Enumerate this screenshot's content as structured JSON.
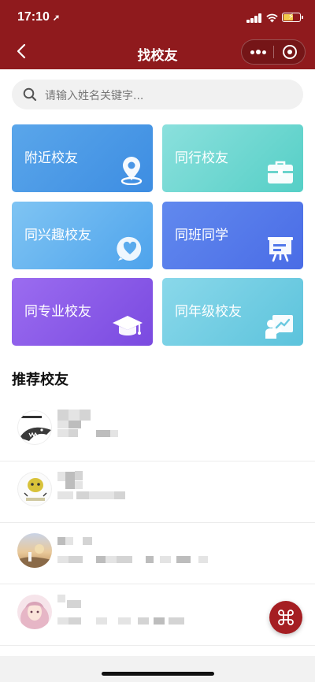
{
  "status_bar": {
    "time": "17:10"
  },
  "nav": {
    "title": "找校友"
  },
  "search": {
    "placeholder": "请输入姓名关键字..."
  },
  "categories": [
    {
      "label": "附近校友",
      "icon": "location-pin-icon"
    },
    {
      "label": "同行校友",
      "icon": "briefcase-icon"
    },
    {
      "label": "同兴趣校友",
      "icon": "heart-bubble-icon"
    },
    {
      "label": "同班同学",
      "icon": "presentation-board-icon"
    },
    {
      "label": "同专业校友",
      "icon": "graduation-cap-icon"
    },
    {
      "label": "同年级校友",
      "icon": "teacher-board-icon"
    }
  ],
  "recommend": {
    "title": "推荐校友"
  },
  "colors": {
    "nav_bg": "#8f1a1d",
    "fab_bg": "#a51e22"
  }
}
